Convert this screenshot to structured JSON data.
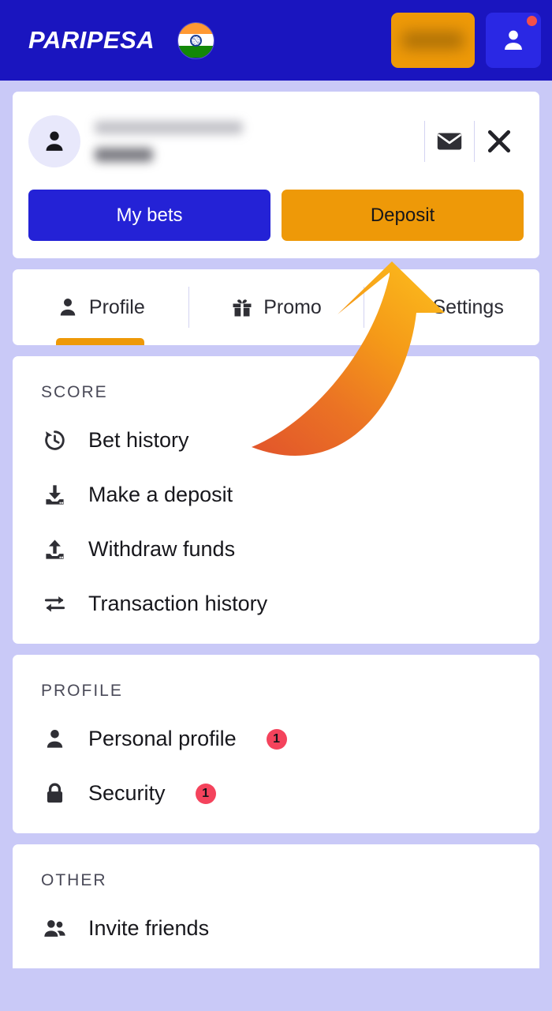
{
  "header": {
    "brand": "PARIPESA",
    "flag_icon": "india-flag-icon",
    "balance_label": "",
    "profile_icon": "person-icon",
    "notification_dot": true,
    "colors": {
      "background": "#1a15bf",
      "accent_orange": "#ee9908",
      "profile_button": "#2a28e4",
      "notification": "#f4504a"
    }
  },
  "account": {
    "avatar_icon": "person-icon",
    "user_id": "",
    "balance": "",
    "mail_icon": "envelope-icon",
    "close_icon": "close-icon",
    "buttons": {
      "my_bets": "My bets",
      "deposit": "Deposit"
    }
  },
  "tabs": [
    {
      "label": "Profile",
      "icon": "person-icon",
      "active": true
    },
    {
      "label": "Promo",
      "icon": "gift-icon",
      "active": false
    },
    {
      "label": "Settings",
      "icon": "gear-icon",
      "active": false
    }
  ],
  "sections": [
    {
      "title": "SCORE",
      "items": [
        {
          "label": "Bet history",
          "icon": "history-icon",
          "badge": ""
        },
        {
          "label": "Make a deposit",
          "icon": "download-icon",
          "badge": ""
        },
        {
          "label": "Withdraw funds",
          "icon": "upload-icon",
          "badge": ""
        },
        {
          "label": "Transaction history",
          "icon": "transfer-icon",
          "badge": ""
        }
      ]
    },
    {
      "title": "PROFILE",
      "items": [
        {
          "label": "Personal profile",
          "icon": "person-icon",
          "badge": "1"
        },
        {
          "label": "Security",
          "icon": "lock-icon",
          "badge": "1"
        }
      ]
    },
    {
      "title": "OTHER",
      "items": [
        {
          "label": "Invite friends",
          "icon": "people-icon",
          "badge": ""
        }
      ]
    }
  ],
  "annotation": {
    "arrow_icon": "curved-up-arrow-annotation",
    "gradient_start": "#e8622a",
    "gradient_end": "#f9b320",
    "points_to": "Deposit"
  },
  "page": {
    "background": "#c9c9f7"
  }
}
